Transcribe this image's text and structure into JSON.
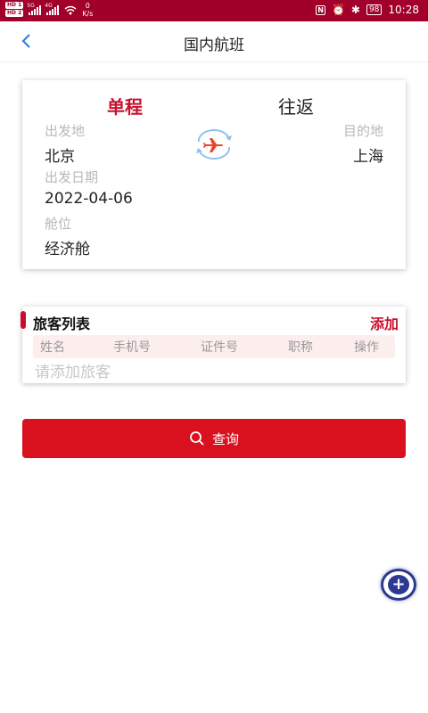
{
  "status_bar": {
    "sim1": "HD 1",
    "sim2": "HD 2",
    "net1": "5G",
    "net2": "4G",
    "speed_value": "0",
    "speed_unit": "K/s",
    "battery": "98",
    "time": "10:28"
  },
  "header": {
    "title": "国内航班",
    "back_icon": "chevron-left-icon"
  },
  "trip": {
    "tab_one_way": "单程",
    "tab_round_trip": "往返",
    "origin_label": "出发地",
    "origin_value": "北京",
    "destination_label": "目的地",
    "destination_value": "上海",
    "date_label": "出发日期",
    "date_value": "2022-04-06",
    "cabin_label": "舱位",
    "cabin_value": "经济舱"
  },
  "passengers": {
    "title": "旅客列表",
    "add_label": "添加",
    "columns": [
      "姓名",
      "手机号",
      "证件号",
      "职称",
      "操作"
    ],
    "empty_hint": "请添加旅客"
  },
  "actions": {
    "query_label": "查询"
  },
  "colors": {
    "brand_red": "#c8102e",
    "status_bar": "#a1002a",
    "fab_blue": "#2c3990"
  }
}
